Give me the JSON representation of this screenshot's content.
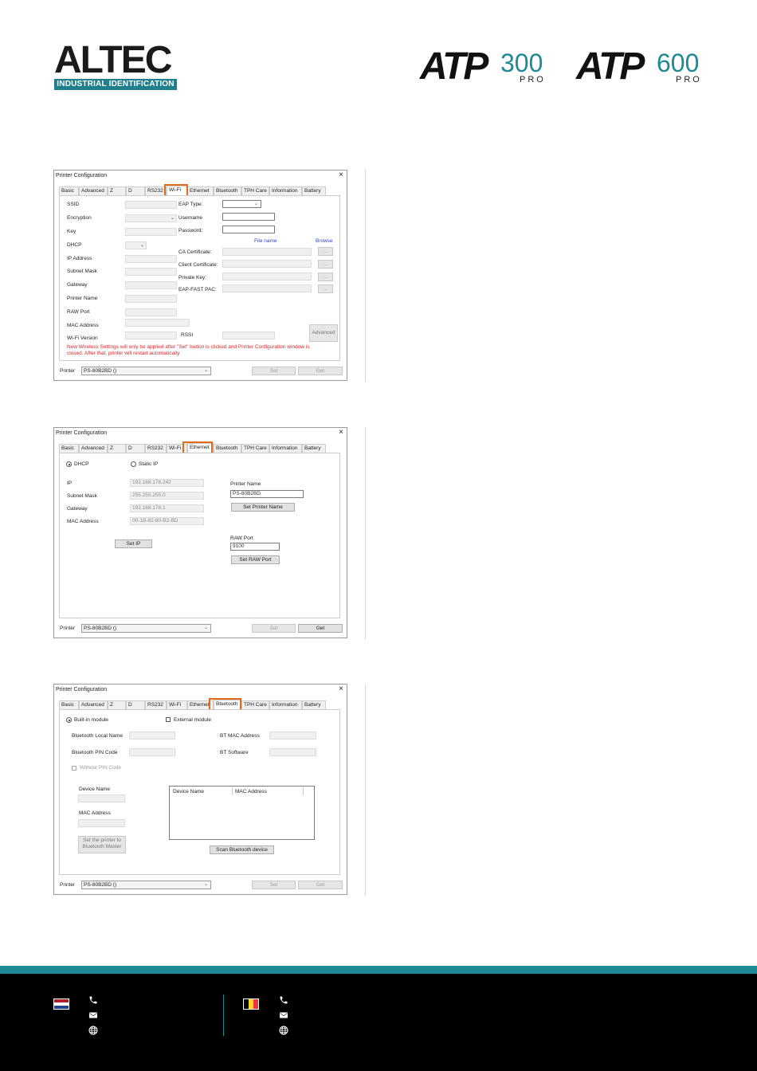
{
  "header": {
    "brand": "ALTEC",
    "brand_tagline": "INDUSTRIAL IDENTIFICATION",
    "models": [
      {
        "name": "ATP",
        "number": "300",
        "suffix": "PRO"
      },
      {
        "name": "ATP",
        "number": "600",
        "suffix": "PRO"
      }
    ]
  },
  "window_title": "Printer Configuration",
  "close_glyph": "×",
  "tabs": [
    "Basic",
    "Advanced",
    "Z",
    "D",
    "RS232",
    "Wi-Fi",
    "Ethernet",
    "Bluetooth",
    "TPH Care",
    "Information",
    "Battery"
  ],
  "printer_label": "Printer",
  "printer_value": "PS-80B2BD ()",
  "set_label": "Set",
  "get_label": "Get",
  "wifi": {
    "labels_left": [
      "SSID",
      "Encryption",
      "Key",
      "DHCP",
      "IP Address",
      "Subnet Mask",
      "Gateway",
      "Printer Name",
      "RAW Port",
      "MAC Address",
      "Wi-Fi Version"
    ],
    "eap_type": "EAP Type:",
    "username": "Username",
    "password": "Password:",
    "file_name": "File name",
    "browse": "Browse",
    "cert_labels": [
      "CA Certificate:",
      "Client Certificate:",
      "Private Key:",
      "EAP-FAST PAC:"
    ],
    "browse_btn": "...",
    "rssi": "RSSI",
    "advanced": "Advanced",
    "warning_line1": "New Wireless Settings will only be applied after \"Set\" button is clicked and Printer Configuration window is",
    "warning_line2": "closed. After that, printer will restart automatically."
  },
  "ethernet": {
    "dhcp": "DHCP",
    "static_ip": "Static IP",
    "ip_label": "IP",
    "ip_value": "192.168.178.242",
    "subnet_label": "Subnet Mask",
    "subnet_value": "255.255.255.0",
    "gateway_label": "Gateway",
    "gateway_value": "192.168.178.1",
    "mac_label": "MAC Address",
    "mac_value": "00-1B-82-80-B2-BD",
    "set_ip": "Set IP",
    "printer_name_label": "Printer Name",
    "printer_name_value": "PS-80B2BD",
    "set_printer_name": "Set Printer Name",
    "raw_port_label": "RAW Port",
    "raw_port_value": "9100",
    "set_raw_port": "Set RAW Port"
  },
  "bluetooth": {
    "built_in": "Built-in module",
    "external": "External module",
    "local_name": "Bluetooth Local Name",
    "pin_code": "Bluetooth PIN Code",
    "bt_mac": "BT MAC Address",
    "bt_software": "BT Software",
    "without_pin": "Without PIN Code",
    "device_name": "Device Name",
    "mac_address": "MAC Address",
    "list_col1": "Device Name",
    "list_col2": "MAC Address",
    "set_master": "Set the printer to Bluetooth Master",
    "scan": "Scan Bluetooth device"
  },
  "colors": {
    "teal": "#1f8a96",
    "highlight": "#e46b1b",
    "warning": "#e0262b"
  },
  "footer_icons": [
    "phone-icon",
    "mail-icon",
    "globe-icon"
  ]
}
